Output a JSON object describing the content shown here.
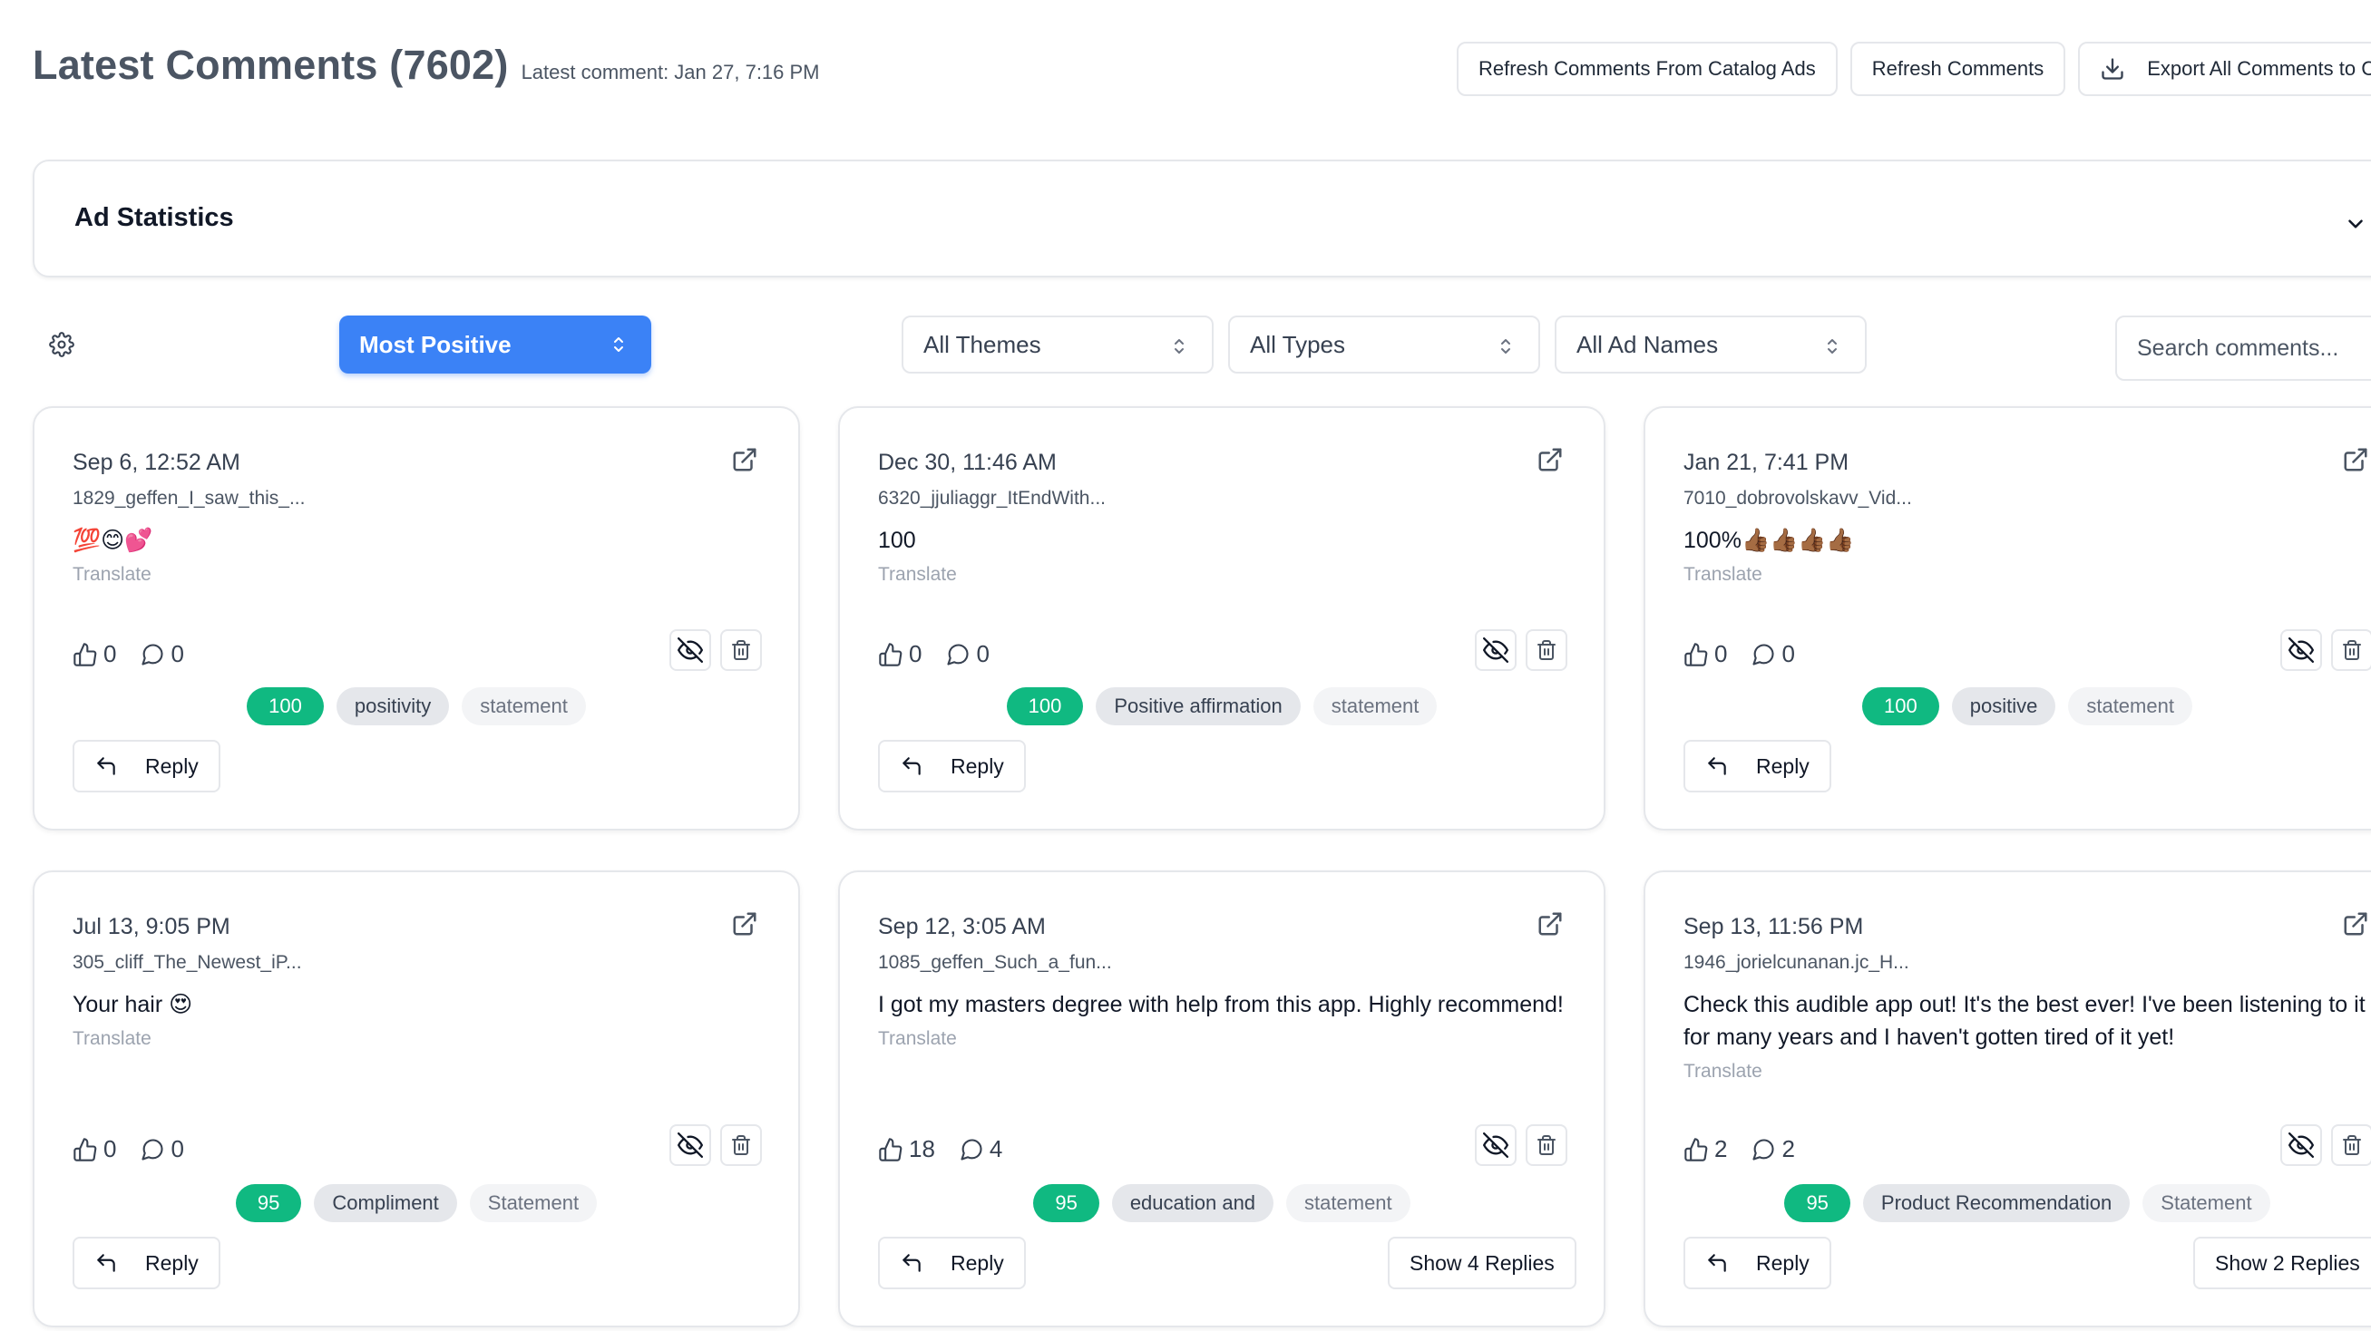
{
  "header": {
    "title": "Latest Comments (7602)",
    "latest": "Latest comment: Jan 27, 7:16 PM"
  },
  "actions": {
    "refresh_catalog": "Refresh Comments From Catalog Ads",
    "refresh": "Refresh Comments",
    "export": "Export All Comments to CSV"
  },
  "ad_stats": {
    "title": "Ad Statistics"
  },
  "filters": {
    "sort": "Most Positive",
    "themes": "All Themes",
    "types": "All Types",
    "ad_names": "All Ad Names",
    "search_placeholder": "Search comments..."
  },
  "card_labels": {
    "translate": "Translate",
    "reply": "Reply"
  },
  "cards": [
    {
      "date": "Sep 6, 12:52 AM",
      "ad": "1829_geffen_I_saw_this_...",
      "text": "💯😊💕",
      "likes": "0",
      "comments": "0",
      "score": "100",
      "theme": "positivity",
      "type": "statement"
    },
    {
      "date": "Dec 30, 11:46 AM",
      "ad": "6320_jjuliaggr_ItEndWith...",
      "text": "100",
      "likes": "0",
      "comments": "0",
      "score": "100",
      "theme": "Positive affirmation",
      "type": "statement"
    },
    {
      "date": "Jan 21, 7:41 PM",
      "ad": "7010_dobrovolskavv_Vid...",
      "text": "100%👍🏾👍🏾👍🏾👍🏾",
      "likes": "0",
      "comments": "0",
      "score": "100",
      "theme": "positive",
      "type": "statement"
    },
    {
      "date": "Jul 13, 9:05 PM",
      "ad": "305_cliff_The_Newest_iP...",
      "text": "Your hair 😍",
      "likes": "0",
      "comments": "0",
      "score": "95",
      "theme": "Compliment",
      "type": "Statement"
    },
    {
      "date": "Sep 12, 3:05 AM",
      "ad": "1085_geffen_Such_a_fun...",
      "text": "I got my masters degree with help from this app. Highly recommend!",
      "likes": "18",
      "comments": "4",
      "score": "95",
      "theme": "education and",
      "type": "statement",
      "replies": "Show 4 Replies"
    },
    {
      "date": "Sep 13, 11:56 PM",
      "ad": "1946_jorielcunanan.jc_H...",
      "text": "Check this audible app out! It's the best ever! I've been listening to it for many years and I haven't gotten tired of it yet!",
      "likes": "2",
      "comments": "2",
      "score": "95",
      "theme": "Product Recommendation",
      "type": "Statement",
      "replies": "Show 2 Replies"
    }
  ],
  "colors": {
    "primary": "#3b82f6",
    "score_green": "#10b981",
    "title_gray": "#4b5563"
  },
  "icons": [
    "download-icon",
    "chevron-down-icon",
    "gear-icon",
    "chevron-updown-icon",
    "external-link-icon",
    "thumbs-up-icon",
    "comment-icon",
    "eye-off-icon",
    "trash-icon",
    "reply-arrow-icon"
  ]
}
